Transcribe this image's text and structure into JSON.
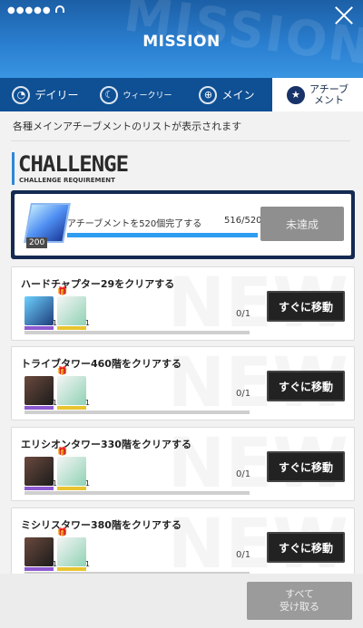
{
  "status": {
    "signal": "●●●●● ",
    "wifi": "wifi-icon"
  },
  "header": {
    "title": "MISSION",
    "bg_text": "MISSION"
  },
  "tabs": [
    {
      "label": "デイリー",
      "icon": "daily-icon"
    },
    {
      "label": "ウィークリー",
      "icon": "weekly-icon"
    },
    {
      "label": "メイン",
      "icon": "globe-icon"
    },
    {
      "label": "アチーブ\nメント",
      "icon": "star-icon",
      "active": true
    }
  ],
  "description": "各種メインアチーブメントのリストが表示されます",
  "challenge": {
    "title": "CHALLENGE",
    "subtitle": "CHALLENGE REQUIREMENT",
    "text": "アチーブメントを520個完了する",
    "count": "516/520",
    "reward_badge": "200",
    "progress": 0.992,
    "button": "未達成"
  },
  "missions": [
    {
      "title": "ハードチャプター29をクリアする",
      "progress": "0/1",
      "button": "すぐに移動"
    },
    {
      "title": "トライブタワー460階をクリアする",
      "progress": "0/1",
      "button": "すぐに移動"
    },
    {
      "title": "エリシオンタワー330階をクリアする",
      "progress": "0/1",
      "button": "すぐに移動"
    },
    {
      "title": "ミシリスタワー380階をクリアする",
      "progress": "0/1",
      "button": "すぐに移動"
    }
  ],
  "footer": {
    "claim_all": "すべて\n受け取る"
  },
  "colors": {
    "header": "#2a7fd0",
    "tabs": "#0f4f93",
    "card_dark": "#142a52",
    "progress": "#2e9cf0"
  }
}
